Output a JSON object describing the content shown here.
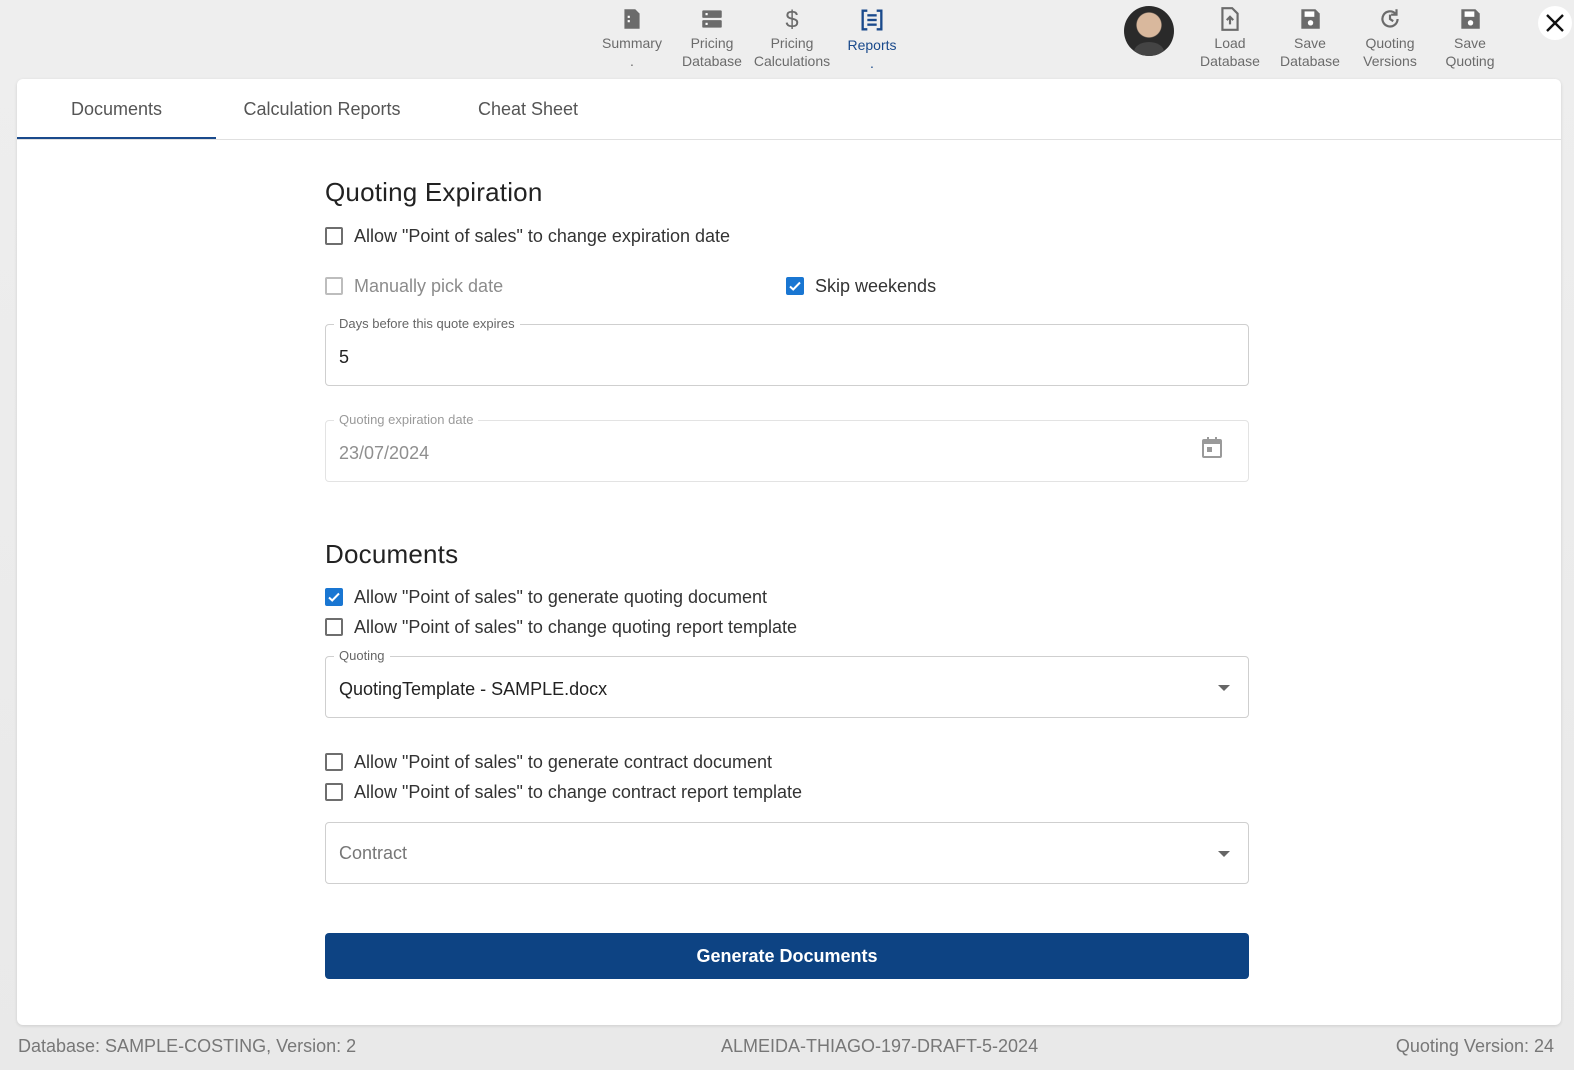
{
  "toolbar": {
    "summary": "Summary\n.",
    "pricing_database": "Pricing\nDatabase",
    "pricing_calculations": "Pricing\nCalculations",
    "reports": "Reports\n.",
    "load_database": "Load\nDatabase",
    "save_database": "Save\nDatabase",
    "quoting_versions": "Quoting\nVersions",
    "save_quoting": "Save\nQuoting"
  },
  "tabs": [
    "Documents",
    "Calculation Reports",
    "Cheat Sheet"
  ],
  "expiration": {
    "heading": "Quoting Expiration",
    "allow_change_expiration": "Allow \"Point of sales\" to change expiration date",
    "manually_pick_date": "Manually pick date",
    "skip_weekends": "Skip weekends",
    "days_label": "Days before this quote expires",
    "days_value": "5",
    "date_label": "Quoting expiration date",
    "date_value": "23/07/2024"
  },
  "documents": {
    "heading": "Documents",
    "allow_generate_quoting": "Allow \"Point of sales\" to generate quoting document",
    "allow_change_quoting_template": "Allow \"Point of sales\" to change quoting report template",
    "quoting_label": "Quoting",
    "quoting_value": "QuotingTemplate - SAMPLE.docx",
    "allow_generate_contract": "Allow \"Point of sales\" to generate contract document",
    "allow_change_contract_template": "Allow \"Point of sales\" to change contract report template",
    "contract_placeholder": "Contract",
    "generate_button": "Generate Documents"
  },
  "footer": {
    "database": "Database: SAMPLE-COSTING, Version: 2",
    "quote_id": "ALMEIDA-THIAGO-197-DRAFT-5-2024",
    "quoting_version": "Quoting Version: 24"
  },
  "colors": {
    "accent": "#1a4a8c",
    "checkbox_checked": "#1976d2",
    "primary_button": "#0d4383"
  },
  "icons": [
    "summary-icon",
    "pricing-database-icon",
    "pricing-calculations-icon",
    "reports-icon",
    "load-database-icon",
    "save-database-icon",
    "quoting-versions-icon",
    "save-quoting-icon",
    "close-icon",
    "calendar-icon",
    "checkmark-icon",
    "dropdown-caret-icon"
  ]
}
